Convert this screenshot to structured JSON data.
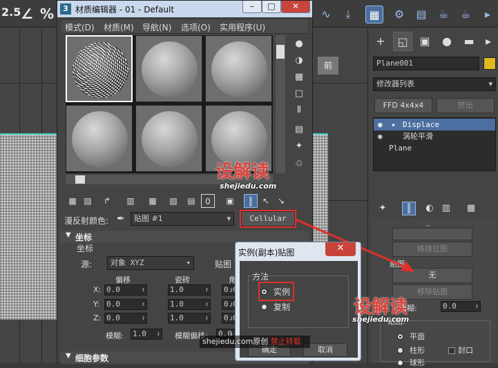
{
  "background": {
    "toolbar_left_icons": [
      "2.5",
      "angle-snap-icon",
      "%"
    ],
    "toolbar_right_icons": [
      "curve-editor-icon",
      "schematic-icon",
      "material-editor-icon",
      "render-setup-icon",
      "render-frame-icon",
      "render-icon"
    ],
    "viewport_tag": "前"
  },
  "command_panel": {
    "tabs": [
      "create-icon",
      "modify-icon",
      "hierarchy-icon",
      "motion-icon",
      "display-icon",
      "utilities-icon"
    ],
    "object_name": "Plane001",
    "object_color": "#e0b820",
    "modifier_list": "修改器列表",
    "buttons": {
      "ffd": "FFD 4x4x4",
      "extrude": "挤出"
    },
    "stack": [
      {
        "label": "Displace",
        "selected": true
      },
      {
        "label": "涡轮平滑",
        "selected": false
      },
      {
        "label": "Plane",
        "selected": false
      }
    ],
    "rollout": {
      "remove_bitmap_top": "移除位图",
      "map_label": "贴图:",
      "map_value": "无",
      "remove_map": "移除贴图",
      "blur_label": "模糊:",
      "blur_value": "0.0",
      "mapping_label": "贴图:",
      "options": [
        "平面",
        "柱形",
        "封口",
        "球形"
      ]
    }
  },
  "material_editor": {
    "title": "材质编辑器 - 01 - Default",
    "menus": [
      "模式(D)",
      "材质(M)",
      "导航(N)",
      "选项(O)",
      "实用程序(U)"
    ],
    "map_row": {
      "label": "漫反射颜色:",
      "map_name": "贴图 #1",
      "type_button": "Cellular"
    },
    "coords": {
      "header": "坐标",
      "subheader": "坐标",
      "source_label": "源:",
      "source_value": "对象 XYZ",
      "map_label": "贴图",
      "col_offset": "偏移",
      "col_tiling": "瓷砖",
      "col_angle": "角",
      "rows": [
        {
          "axis": "X:",
          "offset": "0.0",
          "tiling": "1.0",
          "angle": "0.0"
        },
        {
          "axis": "Y:",
          "offset": "0.0",
          "tiling": "1.0",
          "angle": "0.0"
        },
        {
          "axis": "Z:",
          "offset": "0.0",
          "tiling": "1.0",
          "angle": "0.0"
        }
      ],
      "blur_label": "模糊:",
      "blur_value": "1.0",
      "blur_offset_label": "模糊偏移:",
      "blur_offset_value": "0.0"
    },
    "cell_params": "细胞参数"
  },
  "dialog": {
    "title": "实例(副本)贴图",
    "group_label": "方法",
    "option_instance": "实例",
    "option_copy": "复制",
    "ok": "确定",
    "cancel": "取消"
  },
  "watermark": {
    "brand": "设解读",
    "site": "shejiedu.com",
    "strip_site": "shejiedu.com原创",
    "strip_warning": "禁止转载"
  }
}
